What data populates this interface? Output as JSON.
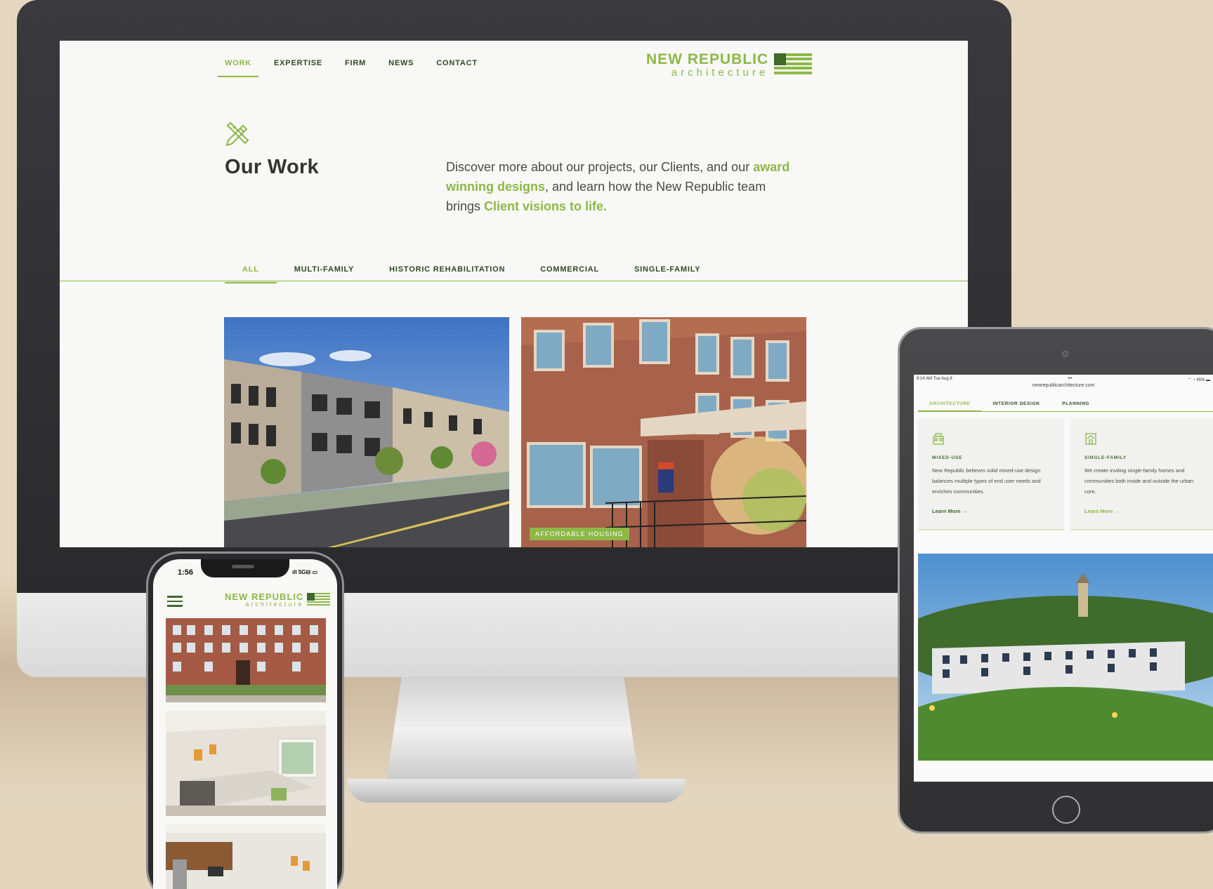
{
  "desktop": {
    "nav": [
      {
        "label": "WORK",
        "active": true
      },
      {
        "label": "EXPERTISE"
      },
      {
        "label": "FIRM"
      },
      {
        "label": "NEWS"
      },
      {
        "label": "CONTACT"
      }
    ],
    "logo": {
      "line1": "NEW REPUBLIC",
      "line2": "architecture"
    },
    "page_title": "Our Work",
    "intro": {
      "part1": "Discover more about our projects, our Clients, and our ",
      "hl1": "award winning designs",
      "part2": ", and learn how the New Republic team brings ",
      "hl2": "Client visions to life."
    },
    "filters": [
      {
        "label": "ALL",
        "active": true
      },
      {
        "label": "MULTI-FAMILY"
      },
      {
        "label": "HISTORIC REHABILITATION"
      },
      {
        "label": "COMMERCIAL"
      },
      {
        "label": "SINGLE-FAMILY"
      }
    ],
    "projects": [
      {
        "icon": "townhouses-rendering-image",
        "tag": ""
      },
      {
        "icon": "brick-apartment-photo",
        "tag": "AFFORDABLE HOUSING"
      }
    ]
  },
  "tablet": {
    "status_time": "9:14 AM   Tue Aug 8",
    "status_dots": "•••",
    "status_right": "⌔ ◔ 45% ▬",
    "url": "newrepublicarchitecture.com",
    "tabs": [
      {
        "label": "ARCHITECTURE",
        "active": true
      },
      {
        "label": "INTERIOR DESIGN"
      },
      {
        "label": "PLANNING"
      }
    ],
    "cards": [
      {
        "icon": "mixed-use-building-icon",
        "title": "MIXED-USE",
        "text": "New Republic believes solid mixed-use design balances multiple types of end user needs and enriches communities.",
        "link": "Learn More →"
      },
      {
        "icon": "house-icon",
        "title": "SINGLE-FAMILY",
        "text": "We create inviting single-family homes and communities both inside and outside the urban core.",
        "link": "Learn More →"
      }
    ]
  },
  "phone": {
    "time": "1:56",
    "signal": "ıll 5G⊟ ▭",
    "logo": {
      "line1": "NEW REPUBLIC",
      "line2": "architecture"
    }
  },
  "colors": {
    "brand_green": "#8cb846",
    "dark_green": "#3f6a2a",
    "background": "#e5d7bf"
  }
}
